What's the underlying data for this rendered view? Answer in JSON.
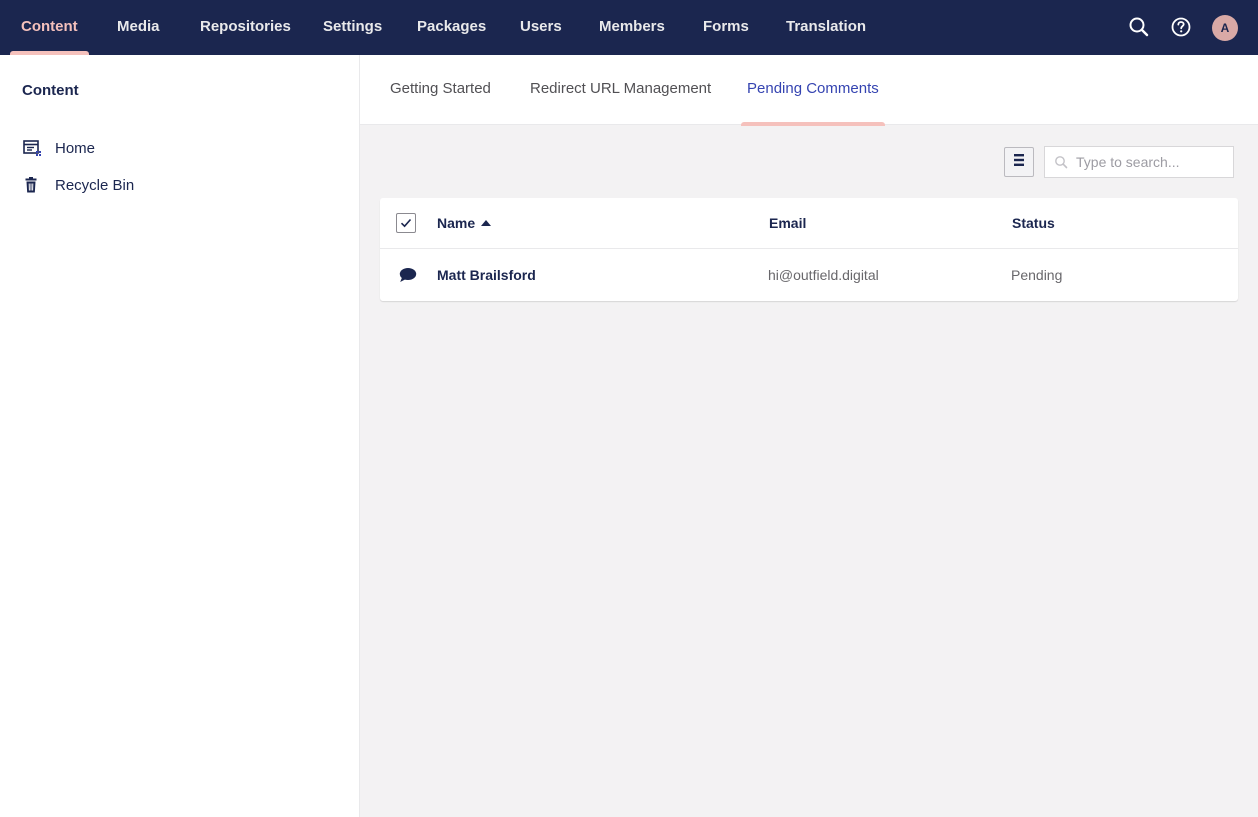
{
  "topnav": {
    "items": [
      {
        "label": "Content",
        "active": true
      },
      {
        "label": "Media"
      },
      {
        "label": "Repositories"
      },
      {
        "label": "Settings"
      },
      {
        "label": "Packages"
      },
      {
        "label": "Users"
      },
      {
        "label": "Members"
      },
      {
        "label": "Forms"
      },
      {
        "label": "Translation"
      }
    ],
    "icons": [
      "search-icon",
      "help-icon"
    ],
    "avatar_initial": "A"
  },
  "sidebar": {
    "title": "Content",
    "items": [
      {
        "label": "Home",
        "icon": "home-page-icon"
      },
      {
        "label": "Recycle Bin",
        "icon": "trash-icon"
      }
    ]
  },
  "tabs": [
    {
      "label": "Getting Started"
    },
    {
      "label": "Redirect URL Management"
    },
    {
      "label": "Pending Comments",
      "active": true
    }
  ],
  "toolbar": {
    "layout_icon": "list-layout-icon",
    "search_placeholder": "Type to search..."
  },
  "table": {
    "columns": [
      "Name",
      "Email",
      "Status"
    ],
    "sort": {
      "column": "Name",
      "direction": "ascending"
    },
    "rows": [
      {
        "icon": "comment-icon",
        "name": "Matt Brailsford",
        "email": "hi@outfield.digital",
        "status": "Pending"
      }
    ]
  },
  "colors": {
    "nav_bg": "#1b264f",
    "accent": "#f5c1bc",
    "active_tab_text": "#3544b1",
    "content_bg": "#f3f2f3"
  }
}
